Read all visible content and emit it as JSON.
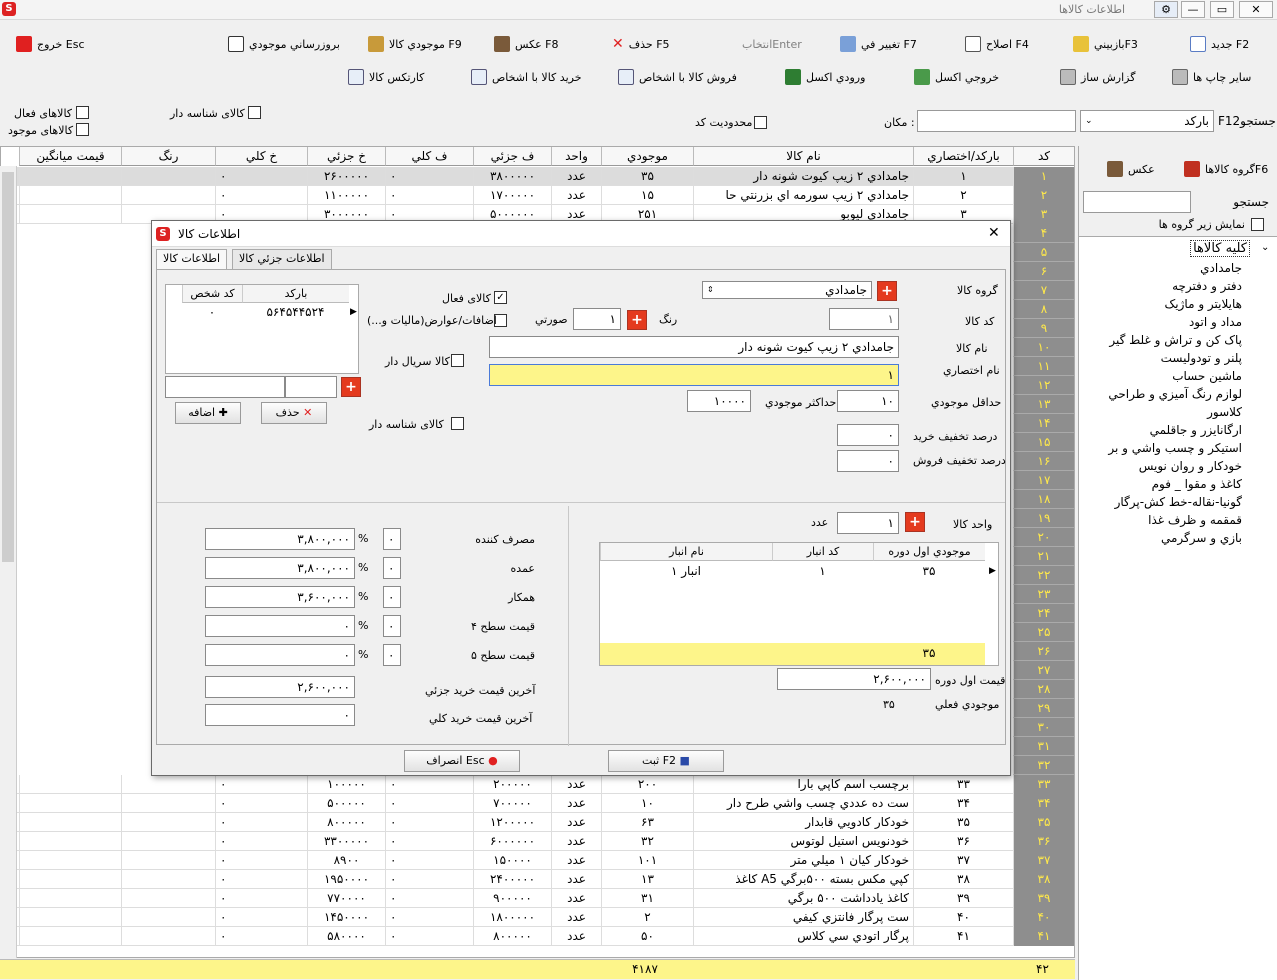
{
  "window": {
    "title": "اطلاعات کالاها",
    "buttons": {
      "close": "✕",
      "maximize": "▭",
      "minimize": "—"
    }
  },
  "toolbar": {
    "row1": [
      {
        "label": "جديد F2",
        "icon": "new-doc-icon"
      },
      {
        "label": "بازبينيF3",
        "icon": "glasses-icon"
      },
      {
        "label": "اصلاح F4",
        "icon": "edit-icon"
      },
      {
        "label": "تغيير في F7",
        "icon": "change-icon"
      },
      {
        "label": "انتخابEnter",
        "icon": ""
      },
      {
        "label": "حذف F5",
        "icon": "delete-icon"
      },
      {
        "label": "عكس F8",
        "icon": "camera-icon"
      },
      {
        "label": "موجودي كالا F9",
        "icon": "box-icon"
      },
      {
        "label": "بروزرساني موجودي",
        "icon": "calculator-icon"
      },
      {
        "label": "خروج Esc",
        "icon": "exit-icon"
      }
    ],
    "row2": [
      {
        "label": "ساير چاپ ها",
        "icon": "printer-icon"
      },
      {
        "label": "گزارش ساز",
        "icon": "printer-icon"
      },
      {
        "label": "خروجي اكسل",
        "icon": "excel-export-icon"
      },
      {
        "label": "ورودي اكسل",
        "icon": "excel-import-icon"
      },
      {
        "label": "فروش كالا با اشخاص",
        "icon": "search-doc-icon"
      },
      {
        "label": "خريد كالا با اشخاص",
        "icon": "search-doc-icon"
      },
      {
        "label": "كارتكس كالا",
        "icon": "search-doc-icon"
      }
    ]
  },
  "filters": {
    "search_label": "F12جستجو",
    "search_by": "باركد",
    "location_label": "مكان :",
    "location_value": "",
    "limit_code_label": "محدوديت كد",
    "serial_label": "كالاى شناسه دار",
    "active_label": "كالاهاى فعال",
    "stock_label": "كالاهاى موجود"
  },
  "grid": {
    "columns": [
      "كد",
      "باركد/اختصاري",
      "نام كالا",
      "موجودي",
      "واحد",
      "ف جزئي",
      "ف كلي",
      "خ جزئي",
      "خ كلي",
      "رنگ",
      "قيمت ميانگين"
    ],
    "rows_top": [
      {
        "kod": "۱",
        "barcode": "۱",
        "name": "جامدادي ۲ زيپ كيوت شونه دار",
        "stock": "۳۵",
        "unit": "عدد",
        "fj": "۳۸۰۰۰۰۰",
        "fk": "۰",
        "kj": "۲۶۰۰۰۰۰",
        "kk": "۰"
      },
      {
        "kod": "۲",
        "barcode": "۲",
        "name": "جامدادي ۲ زيپ سورمه اي بزرنتي حا",
        "stock": "۱۵",
        "unit": "عدد",
        "fj": "۱۷۰۰۰۰۰",
        "fk": "۰",
        "kj": "۱۱۰۰۰۰۰",
        "kk": "۰"
      },
      {
        "kod": "۳",
        "barcode": "۳",
        "name": "جامدادي ليوبو",
        "stock": "۲۵۱",
        "unit": "عدد",
        "fj": "۵۰۰۰۰۰۰",
        "fk": "۰",
        "kj": "۳۰۰۰۰۰۰",
        "kk": "۰"
      }
    ],
    "hidden_kods": [
      "۴",
      "۵",
      "۶",
      "۷",
      "۸",
      "۹",
      "۱۰",
      "۱۱",
      "۱۲",
      "۱۳",
      "۱۴",
      "۱۵",
      "۱۶",
      "۱۷",
      "۱۸",
      "۱۹",
      "۲۰",
      "۲۱",
      "۲۲",
      "۲۳",
      "۲۴",
      "۲۵",
      "۲۶",
      "۲۷",
      "۲۸",
      "۲۹",
      "۳۰",
      "۳۱",
      "۳۲"
    ],
    "rows_bottom": [
      {
        "kod": "۳۳",
        "barcode": "۳۳",
        "name": "برچسب اسم كاپي بارا",
        "stock": "۲۰۰",
        "unit": "عدد",
        "fj": "۲۰۰۰۰۰",
        "fk": "۰",
        "kj": "۱۰۰۰۰۰",
        "kk": "۰"
      },
      {
        "kod": "۳۴",
        "barcode": "۳۴",
        "name": "ست ده عددي چسب واشي طرح دار",
        "stock": "۱۰",
        "unit": "عدد",
        "fj": "۷۰۰۰۰۰",
        "fk": "۰",
        "kj": "۵۰۰۰۰۰",
        "kk": "۰"
      },
      {
        "kod": "۳۵",
        "barcode": "۳۵",
        "name": "خودكار كادويي قابدار",
        "stock": "۶۳",
        "unit": "عدد",
        "fj": "۱۲۰۰۰۰۰",
        "fk": "۰",
        "kj": "۸۰۰۰۰۰",
        "kk": "۰"
      },
      {
        "kod": "۳۶",
        "barcode": "۳۶",
        "name": "خودنويس استيل لوتوس",
        "stock": "۳۲",
        "unit": "عدد",
        "fj": "۶۰۰۰۰۰۰",
        "fk": "۰",
        "kj": "۳۳۰۰۰۰۰",
        "kk": "۰"
      },
      {
        "kod": "۳۷",
        "barcode": "۳۷",
        "name": "خودكار كيان ۱ ميلي متر",
        "stock": "۱۰۱",
        "unit": "عدد",
        "fj": "۱۵۰۰۰۰",
        "fk": "۰",
        "kj": "۸۹۰۰",
        "kk": "۰"
      },
      {
        "kod": "۳۸",
        "barcode": "۳۸",
        "name": "كاغذ A5 كپي مكس بسته ۵۰۰برگي",
        "stock": "۱۳",
        "unit": "عدد",
        "fj": "۲۴۰۰۰۰۰",
        "fk": "۰",
        "kj": "۱۹۵۰۰۰۰",
        "kk": "۰"
      },
      {
        "kod": "۳۹",
        "barcode": "۳۹",
        "name": "كاغذ يادداشت ۵۰۰ برگي",
        "stock": "۳۱",
        "unit": "عدد",
        "fj": "۹۰۰۰۰۰",
        "fk": "۰",
        "kj": "۷۷۰۰۰۰",
        "kk": "۰"
      },
      {
        "kod": "۴۰",
        "barcode": "۴۰",
        "name": "ست پرگار فانتزي كيفي",
        "stock": "۲",
        "unit": "عدد",
        "fj": "۱۸۰۰۰۰۰",
        "fk": "۰",
        "kj": "۱۴۵۰۰۰۰",
        "kk": "۰"
      },
      {
        "kod": "۴۱",
        "barcode": "۴۱",
        "name": "پرگار اتودي سي كلاس",
        "stock": "۵۰",
        "unit": "عدد",
        "fj": "۸۰۰۰۰۰",
        "fk": "۰",
        "kj": "۵۸۰۰۰۰",
        "kk": "۰"
      }
    ],
    "footer_count": "۴۲",
    "footer_stock_total": "۴۱۸۷"
  },
  "right_panel": {
    "group_button": "گروه كالاهاF6",
    "photo_button": "عكس",
    "search_label": "جستجو",
    "search_value": "",
    "show_subgroups_label": "نمايش زير گروه ها",
    "tree_root": "كليه كالاها",
    "tree_items": [
      "جامدادي",
      "دفتر و دفترچه",
      "هايلايتر و ماژيک",
      "مداد و اتود",
      "پاک کن و تراش و غلط گير",
      "پلنر و تودوليست",
      "ماشين حساب",
      "لوازم رنگ آميزي و طراحي",
      "كلاسور",
      "ارگانايزر و جاقلمي",
      "استيكر و چسب واشي و بر",
      "خودكار و روان نويس",
      "كاغذ و مقوا _ فوم",
      "گونيا-نقاله-خط کش-پرگار",
      "قمقمه و ظرف غذا",
      "بازي و سرگرمي"
    ]
  },
  "dialog": {
    "title": "اطلاعات كالا",
    "close": "✕",
    "tabs": [
      "اطلاعات كالا",
      "اطلاعات جزئي كالا"
    ],
    "group_label": "گروه كالا",
    "group_value": "جامدادي",
    "code_label": "كد كالا",
    "code_value": "۱",
    "color_label": "رنگ",
    "color_value": "۱",
    "color_name": "صورتي",
    "name_label": "نام كالا",
    "name_value": "جامدادي ۲ زيپ كيوت شونه دار",
    "short_label": "نام اختصاري",
    "short_value": "۱",
    "min_stock_label": "حداقل موجودي",
    "min_stock_value": "۱۰",
    "max_stock_label": "حداكثر موجودي",
    "max_stock_value": "۱۰۰۰۰",
    "buy_disc_label": "درصد تخفيف خريد",
    "buy_disc_value": "۰",
    "sell_disc_label": "درصد تخفيف فروش",
    "sell_disc_value": "۰",
    "active_label": "كالاى فعال",
    "active_checked": "✓",
    "extras_label": "اضافات/عوارض(ماليات و...)",
    "serial_label": "كالا سريال دار",
    "ident_label": "كالاى شناسه دار",
    "barcode_grid": {
      "cols": [
        "باركد",
        "كد شخص"
      ],
      "rows": [
        {
          "barcode": "۵۶۴۵۴۴۵۲۴",
          "person": "۰"
        }
      ]
    },
    "delete_btn": "حذف",
    "add_btn": "اضافه",
    "unit_label": "واحد كالا",
    "unit_value": "۱",
    "unit_name": "عدد",
    "wh_grid": {
      "cols": [
        "موجودي اول دوره",
        "كد انبار",
        "نام انبار"
      ],
      "rows": [
        {
          "stock": "۳۵",
          "code": "۱",
          "name": "انبار ۱"
        }
      ],
      "total": "۳۵"
    },
    "first_price_label": "قيمت اول دوره",
    "first_price_value": "۲,۶۰۰,۰۰۰",
    "current_stock_label": "موجودي فعلي",
    "current_stock_value": "۳۵",
    "prices": [
      {
        "label": "مصرف كننده",
        "pct": "۰",
        "value": "۳,۸۰۰,۰۰۰"
      },
      {
        "label": "عمده",
        "pct": "۰",
        "value": "۳,۸۰۰,۰۰۰"
      },
      {
        "label": "همكار",
        "pct": "۰",
        "value": "۳,۶۰۰,۰۰۰"
      },
      {
        "label": "قيمت سطح ۴",
        "pct": "۰",
        "value": "۰"
      },
      {
        "label": "قيمت سطح ۵",
        "pct": "۰",
        "value": "۰"
      }
    ],
    "pct_sign": "%",
    "last_buy_part_label": "آخرين قيمت خريد جزئي",
    "last_buy_part_value": "۲,۶۰۰,۰۰۰",
    "last_buy_whole_label": "آخرين قيمت خريد كلي",
    "last_buy_whole_value": "۰",
    "save_btn": "ثبت F2",
    "cancel_btn": "انصراف Esc"
  },
  "colors": {
    "kod_bg": "#8e8e8e",
    "kod_fg": "#ffe94a",
    "footer": "#fdf58a",
    "highlight": "#fdf58a",
    "accent": "#e43a1e"
  }
}
